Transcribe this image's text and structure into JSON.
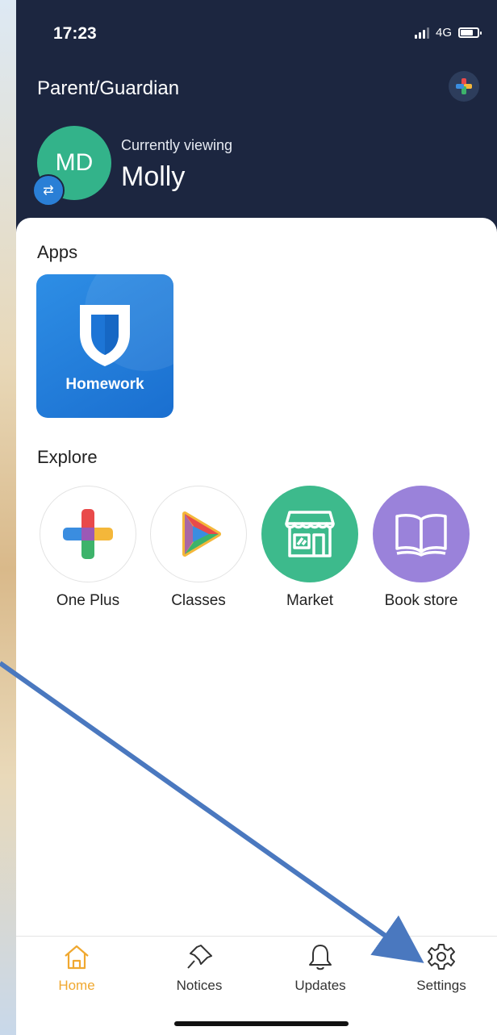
{
  "status_bar": {
    "time": "17:23",
    "network": "4G"
  },
  "header": {
    "role": "Parent/Guardian",
    "avatar_initials": "MD",
    "viewing_label": "Currently viewing",
    "viewing_name": "Molly"
  },
  "apps": {
    "title": "Apps",
    "items": [
      {
        "label": "Homework"
      }
    ]
  },
  "explore": {
    "title": "Explore",
    "items": [
      {
        "label": "One Plus"
      },
      {
        "label": "Classes"
      },
      {
        "label": "Market"
      },
      {
        "label": "Book store"
      }
    ]
  },
  "tabbar": {
    "tabs": [
      {
        "label": "Home",
        "active": true
      },
      {
        "label": "Notices"
      },
      {
        "label": "Updates"
      },
      {
        "label": "Settings"
      }
    ]
  },
  "colors": {
    "header_bg": "#1c2640",
    "accent": "#f0a830",
    "annotation_arrow": "#4a78bf"
  }
}
